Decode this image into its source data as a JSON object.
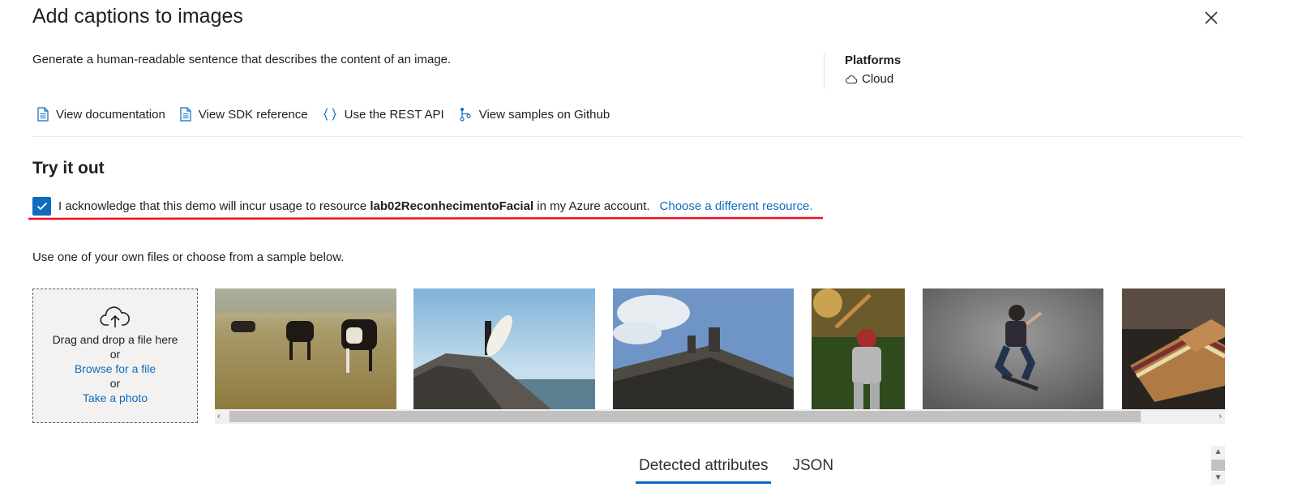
{
  "page": {
    "title": "Add captions to images",
    "description": "Generate a human-readable sentence that describes the content of an image."
  },
  "platforms": {
    "label": "Platforms",
    "value": "Cloud",
    "icon": "cloud-icon"
  },
  "links": [
    {
      "label": "View documentation",
      "icon": "document-icon"
    },
    {
      "label": "View SDK reference",
      "icon": "document-icon"
    },
    {
      "label": "Use the REST API",
      "icon": "braces-icon"
    },
    {
      "label": "View samples on Github",
      "icon": "branch-icon"
    }
  ],
  "try_it": {
    "heading": "Try it out",
    "ack_prefix": "I acknowledge that this demo will incur usage to resource",
    "resource_name": "lab02ReconhecimentoFacial",
    "ack_suffix": "in my Azure account.",
    "change_link": "Choose a different resource.",
    "checked": true,
    "use_text": "Use one of your own files or choose from a sample below."
  },
  "dropzone": {
    "line1": "Drag and drop a file here",
    "or1": "or",
    "browse": "Browse for a file",
    "or2": "or",
    "photo": "Take a photo"
  },
  "samples": [
    "cows-in-field",
    "surfer-on-rock",
    "building-statue",
    "baseball-batter",
    "skateboarder",
    "sandwich"
  ],
  "tabs": [
    {
      "label": "Detected attributes",
      "active": true
    },
    {
      "label": "JSON",
      "active": false
    }
  ],
  "colors": {
    "accent": "#0f6cbd",
    "annotation_red": "#e81123"
  }
}
